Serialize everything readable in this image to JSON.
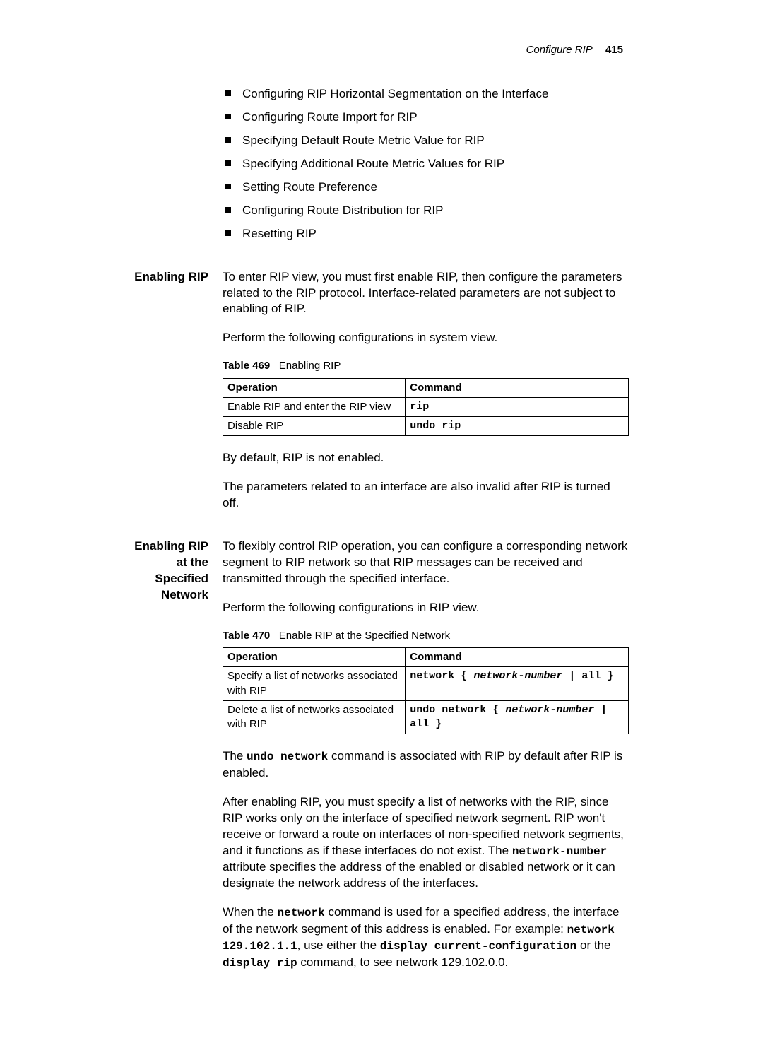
{
  "running_head": {
    "section": "Configure RIP",
    "page": "415"
  },
  "bullets": [
    "Configuring RIP Horizontal Segmentation on the Interface",
    "Configuring Route Import for RIP",
    "Specifying Default Route Metric Value for RIP",
    "Specifying Additional Route Metric Values for RIP",
    "Setting Route Preference",
    "Configuring Route Distribution for RIP",
    "Resetting RIP"
  ],
  "sections": {
    "enabling_rip": {
      "label": "Enabling RIP",
      "para1": "To enter RIP view, you must first enable RIP, then configure the parameters related to the RIP protocol. Interface-related parameters are not subject to enabling of RIP.",
      "para2": "Perform the following configurations in system view.",
      "table_caption_label": "Table 469",
      "table_caption_text": "Enabling RIP",
      "table": {
        "headers": {
          "op": "Operation",
          "cmd": "Command"
        },
        "rows": [
          {
            "op": "Enable RIP and enter the RIP view",
            "cmd": "rip"
          },
          {
            "op": "Disable RIP",
            "cmd": "undo rip"
          }
        ]
      },
      "para3": "By default, RIP is not enabled.",
      "para4": "The parameters related to an interface are also invalid after RIP is turned off."
    },
    "enabling_rip_network": {
      "label": "Enabling RIP at the Specified Network",
      "para1": "To flexibly control RIP operation, you can configure a corresponding network segment to RIP network so that RIP messages can be received and transmitted through the specified interface.",
      "para2": "Perform the following configurations in RIP view.",
      "table_caption_label": "Table 470",
      "table_caption_text": "Enable RIP at the Specified Network",
      "table": {
        "headers": {
          "op": "Operation",
          "cmd": "Command"
        },
        "rows": [
          {
            "op": "Specify a list of networks associated with RIP",
            "cmd_pre": "network { ",
            "cmd_arg": "network-number",
            "cmd_post": " | all }"
          },
          {
            "op": "Delete a list of networks associated with RIP",
            "cmd_pre": "undo network { ",
            "cmd_arg": "network-number",
            "cmd_post": " | all }"
          }
        ]
      },
      "para3_pre": "The ",
      "para3_cmd": "undo network",
      "para3_post": " command is associated with RIP by default after RIP is enabled.",
      "para4_pre": "After enabling RIP, you must specify a list of networks with the RIP, since RIP works only on the interface of specified network segment. RIP won't receive or forward a route on interfaces of non-specified network segments, and it functions as if these interfaces do not exist. The ",
      "para4_cmd": "network-number",
      "para4_post": " attribute specifies the address of the enabled or disabled network or it can designate the network address of the interfaces.",
      "para5_pre": "When the ",
      "para5_cmd1": "network",
      "para5_mid1": " command is used for a specified address, the interface of the network segment of this address is enabled. For example: ",
      "para5_cmd2": "network 129.102.1.1",
      "para5_mid2": ", use either the ",
      "para5_cmd3": "display current-configuration",
      "para5_mid3": " or the ",
      "para5_cmd4": "display rip",
      "para5_post": " command, to see network 129.102.0.0."
    }
  }
}
